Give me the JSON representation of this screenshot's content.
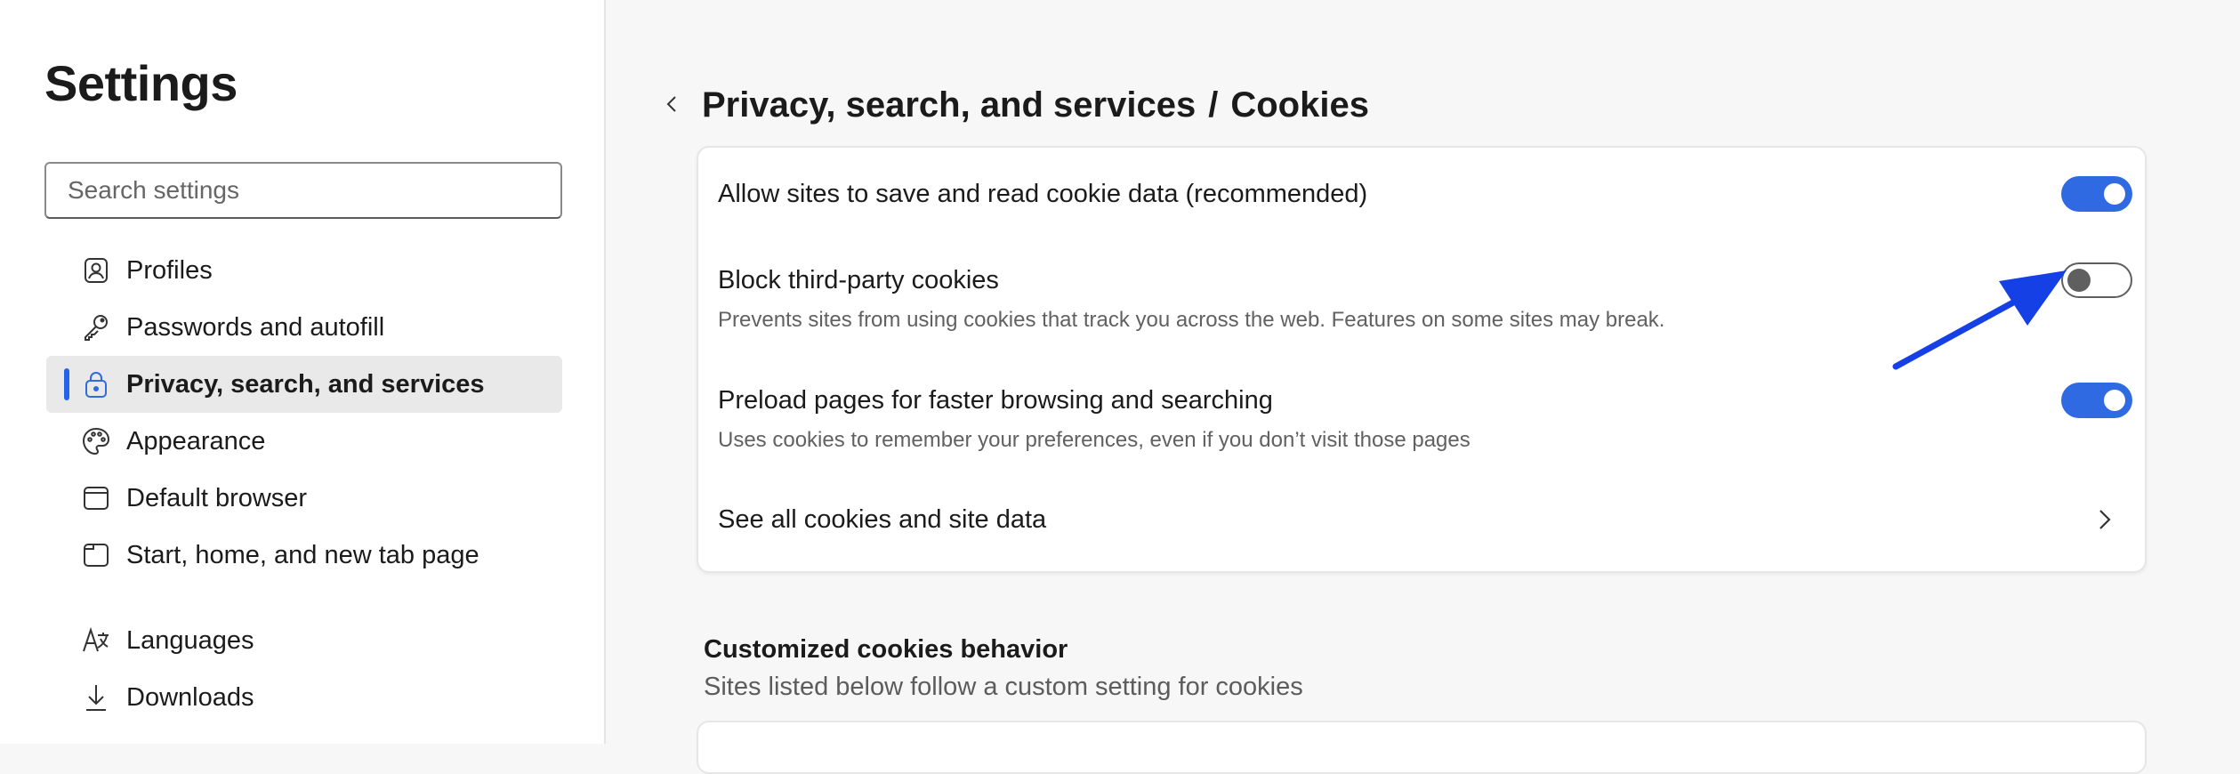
{
  "sidebar": {
    "title": "Settings",
    "search": {
      "placeholder": "Search settings",
      "value": ""
    },
    "items": [
      {
        "label": "Profiles",
        "icon": "profile-icon",
        "active": false
      },
      {
        "label": "Passwords and autofill",
        "icon": "key-icon",
        "active": false
      },
      {
        "label": "Privacy, search, and services",
        "icon": "lock-icon",
        "active": true
      },
      {
        "label": "Appearance",
        "icon": "palette-icon",
        "active": false
      },
      {
        "label": "Default browser",
        "icon": "browser-icon",
        "active": false
      },
      {
        "label": "Start, home, and new tab page",
        "icon": "home-tab-icon",
        "active": false
      },
      {
        "label": "Languages",
        "icon": "languages-icon",
        "active": false
      },
      {
        "label": "Downloads",
        "icon": "download-icon",
        "active": false
      }
    ]
  },
  "main": {
    "breadcrumb": {
      "parent": "Privacy, search, and services",
      "separator": "/",
      "current": "Cookies"
    },
    "settings": [
      {
        "title": "Allow sites to save and read cookie data (recommended)",
        "description": "",
        "enabled": true
      },
      {
        "title": "Block third-party cookies",
        "description": "Prevents sites from using cookies that track you across the web. Features on some sites may break.",
        "enabled": false
      },
      {
        "title": "Preload pages for faster browsing and searching",
        "description": "Uses cookies to remember your preferences, even if you don’t visit those pages",
        "enabled": true
      }
    ],
    "link_row": {
      "label": "See all cookies and site data"
    },
    "custom_section": {
      "title": "Customized cookies behavior",
      "description": "Sites listed below follow a custom setting for cookies"
    }
  },
  "colors": {
    "accent": "#2f6ae2",
    "annotation_arrow": "#1440e6",
    "active_indicator": "#2563eb"
  }
}
